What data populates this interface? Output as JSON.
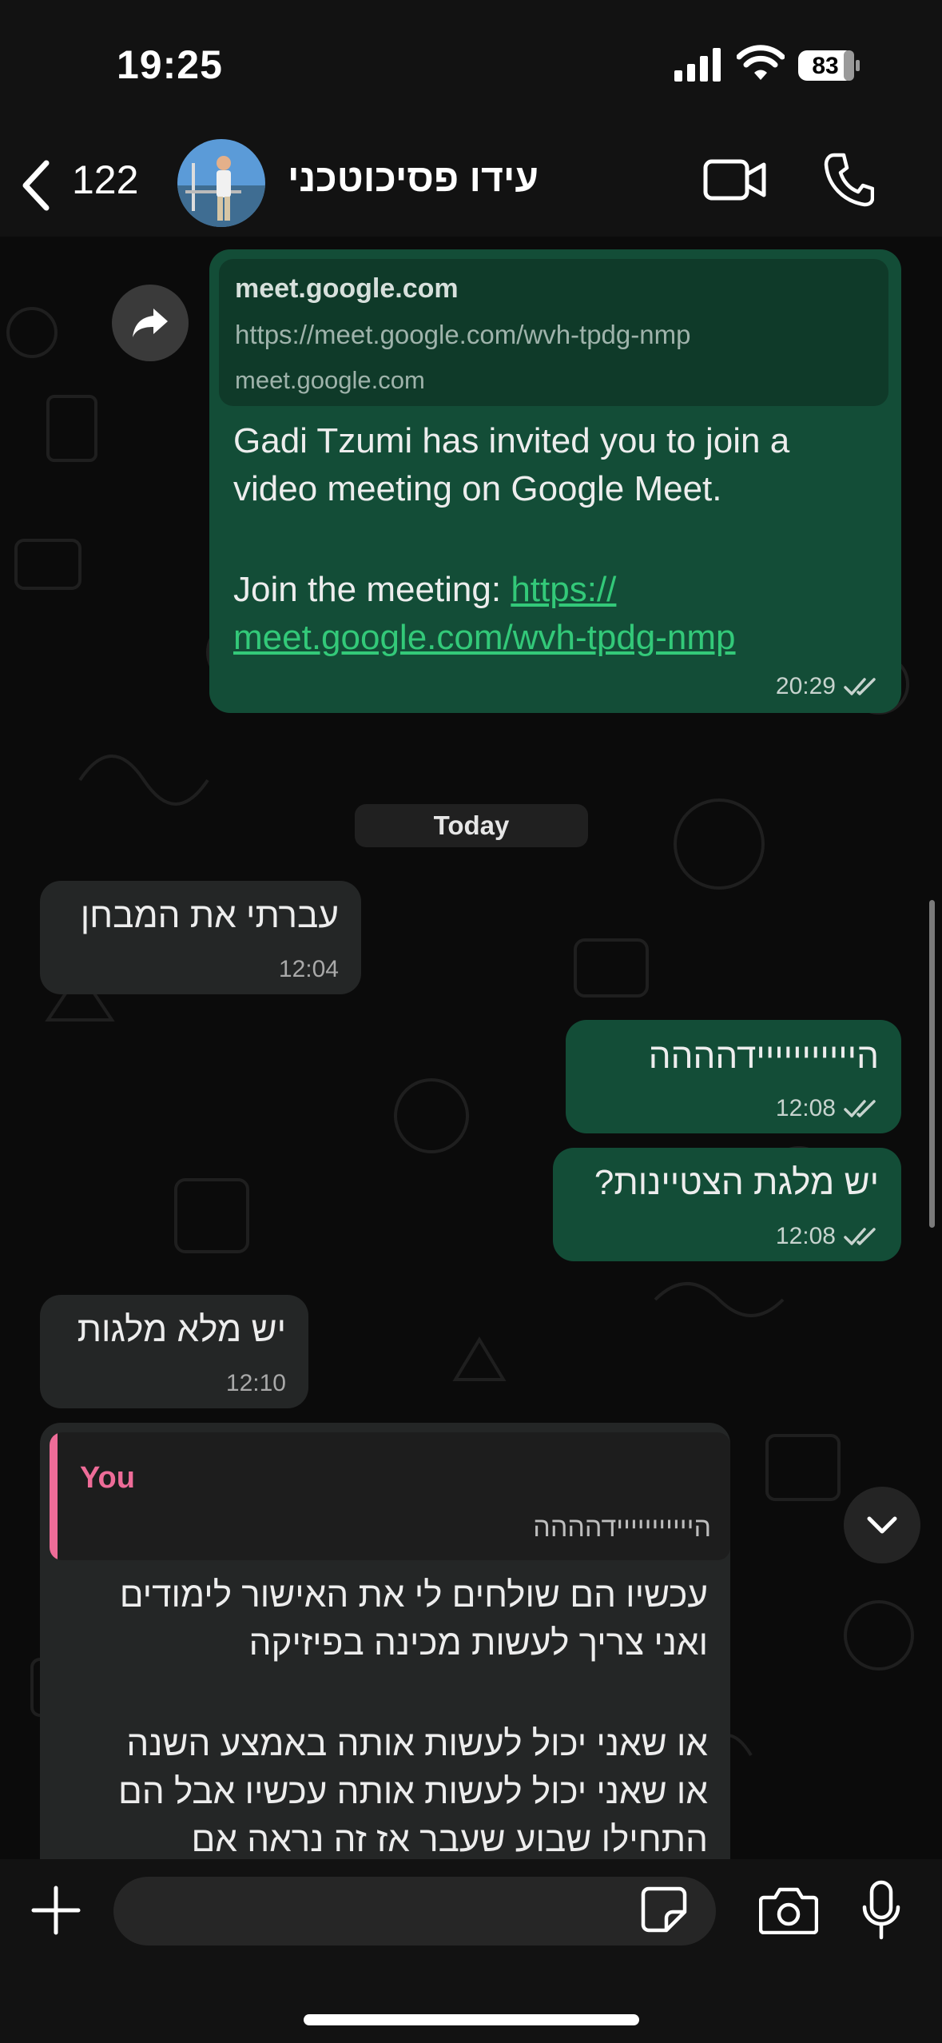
{
  "status_bar": {
    "time": "19:25",
    "battery": "83"
  },
  "header": {
    "back_count": "122",
    "contact_name": "עידו פסיכוטכני"
  },
  "messages": {
    "link_msg": {
      "preview_title": "meet.google.com",
      "preview_url": "https://meet.google.com/wvh-tpdg-nmp",
      "preview_domain": "meet.google.com",
      "line1": "Gadi Tzumi has invited you to join a",
      "line2": "video meeting on Google Meet.",
      "join_prefix": "Join the meeting: ",
      "link_part1": "https://",
      "link_part2": "meet.google.com/wvh-tpdg-nmp",
      "time": "20:29"
    },
    "date_separator": "Today",
    "m1": {
      "text": "עברתי את המבחן",
      "time": "12:04"
    },
    "m2": {
      "text": "הייייייייייידהההה",
      "time": "12:08"
    },
    "m3": {
      "text": "יש מלגת הצטיינות?",
      "time": "12:08"
    },
    "m4": {
      "text": "יש מלא מלגות",
      "time": "12:10"
    },
    "m5": {
      "quote_author": "You",
      "quote_text": "הייייייייייידהההה",
      "line1": "עכשיו הם שולחים לי את האישור לימודים",
      "line2": "ואני צריך לעשות מכינה בפיזיקה",
      "line3": "או שאני יכול לעשות אותה באמצע השנה",
      "line4": "או שאני יכול לעשות אותה עכשיו אבל הם",
      "line5": "התחילו שבוע שעבר אז זה נראה אם"
    }
  },
  "colors": {
    "outgoing_bubble": "#134d37",
    "incoming_bubble": "#242626",
    "link": "#33c979",
    "quote_accent": "#ee6c98",
    "read_ticks": "#c7d3ce"
  },
  "icons": [
    "back-chevron-icon",
    "video-call-icon",
    "phone-call-icon",
    "forward-icon",
    "double-check-icon",
    "chevron-down-icon",
    "plus-icon",
    "sticker-icon",
    "camera-icon",
    "microphone-icon"
  ]
}
